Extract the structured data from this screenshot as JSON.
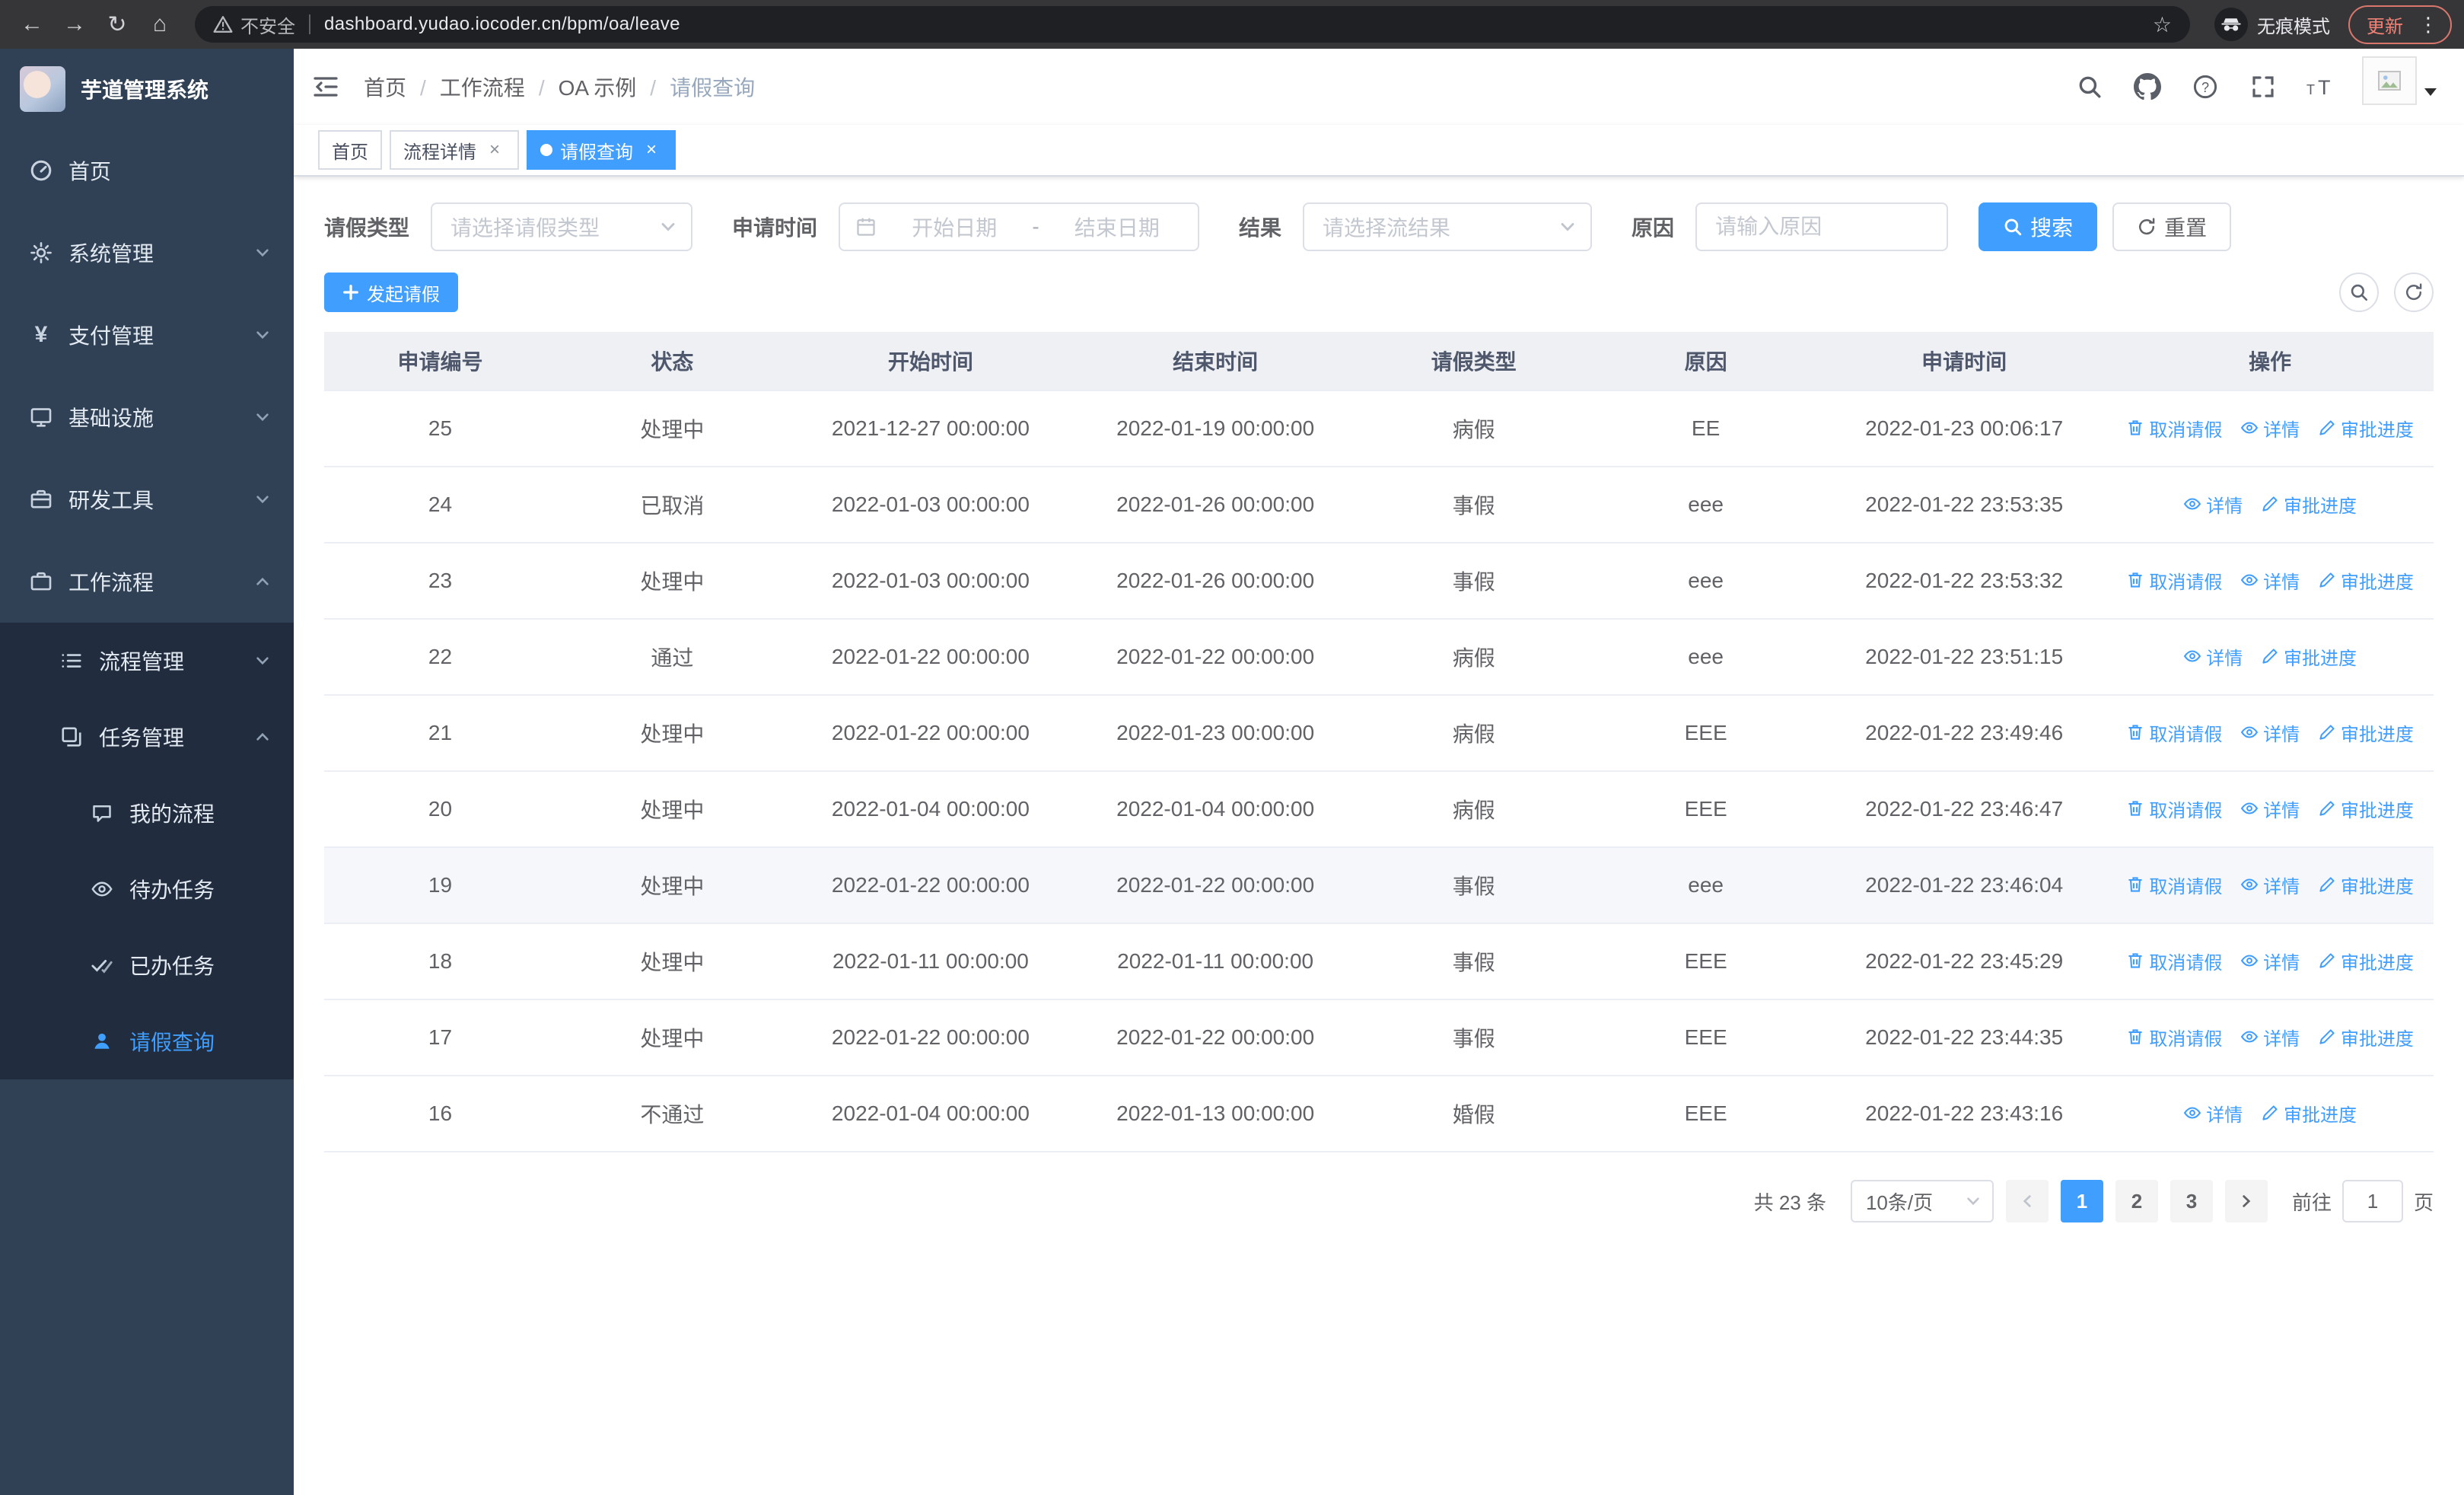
{
  "colors": {
    "primary": "#409eff",
    "sidebar_bg": "#304156",
    "submenu_bg": "#212d3e",
    "update_badge": "#ee8276"
  },
  "icons": [
    "back-icon",
    "forward-icon",
    "reload-icon",
    "home-icon",
    "warning-icon",
    "star-icon",
    "incognito-icon",
    "kebab-menu-icon",
    "collapse-sidebar-icon",
    "search-icon",
    "github-icon",
    "help-icon",
    "fullscreen-icon",
    "font-size-icon",
    "caret-down-icon",
    "dashboard-icon",
    "gear-icon",
    "yen-icon",
    "monitor-icon",
    "toolbox-icon",
    "briefcase-icon",
    "list-icon",
    "layers-icon",
    "chat-icon",
    "eye-icon",
    "double-check-icon",
    "user-icon",
    "calendar-icon",
    "plus-icon",
    "refresh-icon",
    "trash-icon",
    "pen-icon",
    "chevron-left-icon",
    "chevron-right-icon"
  ],
  "browser": {
    "security_chip": "不安全",
    "url": "dashboard.yudao.iocoder.cn/bpm/oa/leave",
    "incognito_label": "无痕模式",
    "update_label": "更新"
  },
  "sidebar": {
    "logo_title": "芋道管理系统",
    "menu": {
      "home": "首页",
      "system": "系统管理",
      "payment": "支付管理",
      "infra": "基础设施",
      "devtools": "研发工具",
      "workflow": "工作流程",
      "process_mgmt": "流程管理",
      "task_mgmt": "任务管理",
      "my_process": "我的流程",
      "todo_tasks": "待办任务",
      "done_tasks": "已办任务",
      "leave_query": "请假查询"
    }
  },
  "header": {
    "breadcrumb": [
      "首页",
      "工作流程",
      "OA 示例",
      "请假查询"
    ]
  },
  "tabs": [
    {
      "label": "首页",
      "active": false,
      "closable": false
    },
    {
      "label": "流程详情",
      "active": false,
      "closable": true
    },
    {
      "label": "请假查询",
      "active": true,
      "closable": true
    }
  ],
  "filters": {
    "leave_type_label": "请假类型",
    "leave_type_placeholder": "请选择请假类型",
    "apply_time_label": "申请时间",
    "start_date_placeholder": "开始日期",
    "range_separator": "-",
    "end_date_placeholder": "结束日期",
    "result_label": "结果",
    "result_placeholder": "请选择流结果",
    "reason_label": "原因",
    "reason_placeholder": "请输入原因",
    "search_button": "搜索",
    "reset_button": "重置"
  },
  "toolbar": {
    "create_button": "发起请假"
  },
  "table": {
    "columns": [
      "申请编号",
      "状态",
      "开始时间",
      "结束时间",
      "请假类型",
      "原因",
      "申请时间",
      "操作"
    ],
    "action_labels": {
      "cancel": "取消请假",
      "detail": "详情",
      "progress": "审批进度"
    },
    "rows": [
      {
        "id": "25",
        "status": "处理中",
        "start": "2021-12-27 00:00:00",
        "end": "2022-01-19 00:00:00",
        "type": "病假",
        "reason": "EE",
        "apply_time": "2022-01-23 00:06:17",
        "has_cancel": "true",
        "highlighted": "false"
      },
      {
        "id": "24",
        "status": "已取消",
        "start": "2022-01-03 00:00:00",
        "end": "2022-01-26 00:00:00",
        "type": "事假",
        "reason": "eee",
        "apply_time": "2022-01-22 23:53:35",
        "has_cancel": "false",
        "highlighted": "false"
      },
      {
        "id": "23",
        "status": "处理中",
        "start": "2022-01-03 00:00:00",
        "end": "2022-01-26 00:00:00",
        "type": "事假",
        "reason": "eee",
        "apply_time": "2022-01-22 23:53:32",
        "has_cancel": "true",
        "highlighted": "false"
      },
      {
        "id": "22",
        "status": "通过",
        "start": "2022-01-22 00:00:00",
        "end": "2022-01-22 00:00:00",
        "type": "病假",
        "reason": "eee",
        "apply_time": "2022-01-22 23:51:15",
        "has_cancel": "false",
        "highlighted": "false"
      },
      {
        "id": "21",
        "status": "处理中",
        "start": "2022-01-22 00:00:00",
        "end": "2022-01-23 00:00:00",
        "type": "病假",
        "reason": "EEE",
        "apply_time": "2022-01-22 23:49:46",
        "has_cancel": "true",
        "highlighted": "false"
      },
      {
        "id": "20",
        "status": "处理中",
        "start": "2022-01-04 00:00:00",
        "end": "2022-01-04 00:00:00",
        "type": "病假",
        "reason": "EEE",
        "apply_time": "2022-01-22 23:46:47",
        "has_cancel": "true",
        "highlighted": "false"
      },
      {
        "id": "19",
        "status": "处理中",
        "start": "2022-01-22 00:00:00",
        "end": "2022-01-22 00:00:00",
        "type": "事假",
        "reason": "eee",
        "apply_time": "2022-01-22 23:46:04",
        "has_cancel": "true",
        "highlighted": "true"
      },
      {
        "id": "18",
        "status": "处理中",
        "start": "2022-01-11 00:00:00",
        "end": "2022-01-11 00:00:00",
        "type": "事假",
        "reason": "EEE",
        "apply_time": "2022-01-22 23:45:29",
        "has_cancel": "true",
        "highlighted": "false"
      },
      {
        "id": "17",
        "status": "处理中",
        "start": "2022-01-22 00:00:00",
        "end": "2022-01-22 00:00:00",
        "type": "事假",
        "reason": "EEE",
        "apply_time": "2022-01-22 23:44:35",
        "has_cancel": "true",
        "highlighted": "false"
      },
      {
        "id": "16",
        "status": "不通过",
        "start": "2022-01-04 00:00:00",
        "end": "2022-01-13 00:00:00",
        "type": "婚假",
        "reason": "EEE",
        "apply_time": "2022-01-22 23:43:16",
        "has_cancel": "false",
        "highlighted": "false"
      }
    ]
  },
  "pagination": {
    "total_text": "共 23 条",
    "page_size": "10条/页",
    "pages": [
      "1",
      "2",
      "3"
    ],
    "active_page": "1",
    "goto_label": "前往",
    "goto_value": "1",
    "goto_suffix": "页"
  }
}
